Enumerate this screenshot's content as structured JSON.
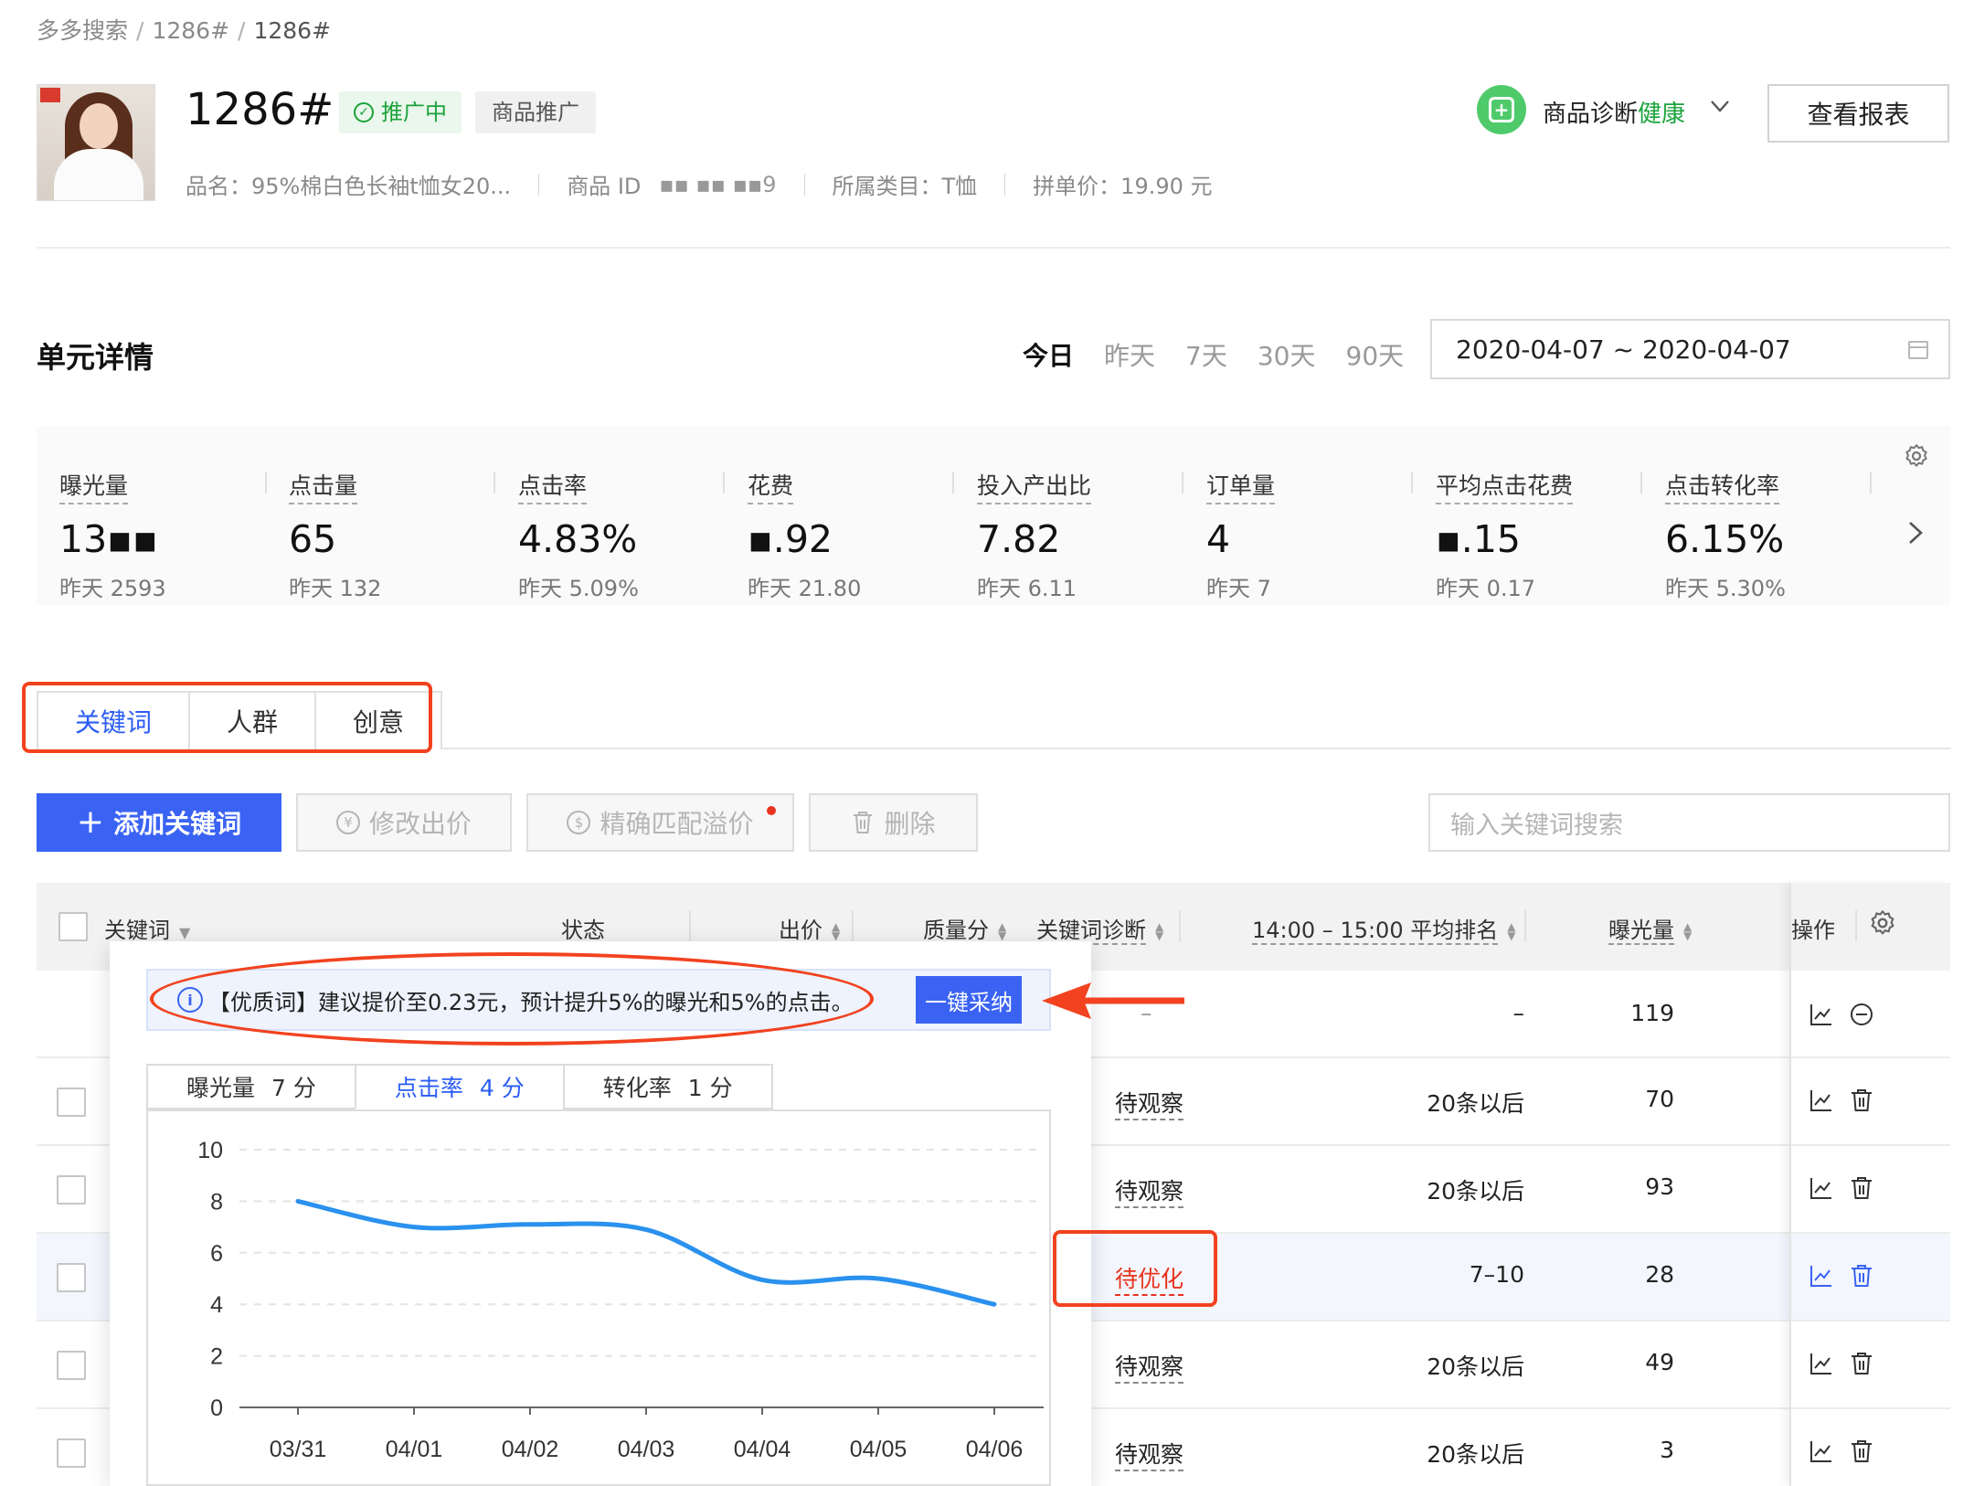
{
  "breadcrumb": {
    "items": [
      "多多搜索",
      "1286#"
    ],
    "current": "1286#"
  },
  "product": {
    "title": "1286#",
    "status": "推广中",
    "type": "商品推广",
    "meta": {
      "name_label": "品名：95%棉白色长袖t恤女20...",
      "id_label": "商品 ID",
      "id_value": "▪▪ ▪▪ ▪▪9",
      "category": "所属类目：T恤",
      "price": "拼单价：19.90 元"
    }
  },
  "header_actions": {
    "diagnosis_label": "商品诊断",
    "diagnosis_status": "健康",
    "report_button": "查看报表"
  },
  "section": {
    "title": "单元详情",
    "ranges": [
      "今日",
      "昨天",
      "7天",
      "30天",
      "90天"
    ],
    "active_range": "今日",
    "date_range": "2020-04-07 ~ 2020-04-07"
  },
  "metrics": [
    {
      "label": "曝光量",
      "value": "13▪▪",
      "prev": "昨天 2593"
    },
    {
      "label": "点击量",
      "value": "65",
      "prev": "昨天 132"
    },
    {
      "label": "点击率",
      "value": "4.83%",
      "prev": "昨天 5.09%"
    },
    {
      "label": "花费",
      "value": "▪.92",
      "prev": "昨天 21.80"
    },
    {
      "label": "投入产出比",
      "value": "7.82",
      "prev": "昨天 6.11"
    },
    {
      "label": "订单量",
      "value": "4",
      "prev": "昨天 7"
    },
    {
      "label": "平均点击花费",
      "value": "▪.15",
      "prev": "昨天 0.17"
    },
    {
      "label": "点击转化率",
      "value": "6.15%",
      "prev": "昨天 5.30%"
    }
  ],
  "tabs": [
    "关键词",
    "人群",
    "创意"
  ],
  "active_tab": "关键词",
  "toolbar": {
    "add_keyword": "添加关键词",
    "edit_bid": "修改出价",
    "exact_premium": "精确匹配溢价",
    "delete": "删除",
    "search_placeholder": "输入关键词搜索"
  },
  "table": {
    "headers": {
      "keyword": "关键词",
      "status": "状态",
      "bid": "出价",
      "quality": "质量分",
      "diagnosis": "关键词诊断",
      "rank": "14:00 – 15:00 平均排名",
      "impressions": "曝光量",
      "ops": "操作"
    },
    "rows": [
      {
        "diagnosis": "–",
        "rank": "–",
        "impressions": "119",
        "diag_kind": "none"
      },
      {
        "diagnosis": "待观察",
        "rank": "20条以后",
        "impressions": "70",
        "diag_kind": "watch"
      },
      {
        "diagnosis": "待观察",
        "rank": "20条以后",
        "impressions": "93",
        "diag_kind": "watch"
      },
      {
        "diagnosis": "待优化",
        "rank": "7–10",
        "impressions": "28",
        "diag_kind": "optimize"
      },
      {
        "diagnosis": "待观察",
        "rank": "20条以后",
        "impressions": "49",
        "diag_kind": "watch"
      },
      {
        "diagnosis": "待观察",
        "rank": "20条以后",
        "impressions": "3",
        "diag_kind": "watch"
      }
    ]
  },
  "popover": {
    "banner": "【优质词】建议提价至0.23元，预计提升5%的曝光和5%的点击。",
    "accept_button": "一键采纳",
    "tabs": [
      {
        "label": "曝光量",
        "score": "7 分"
      },
      {
        "label": "点击率",
        "score": "4 分"
      },
      {
        "label": "转化率",
        "score": "1 分"
      }
    ],
    "active_tab": "点击率"
  },
  "chart_data": {
    "type": "line",
    "x": [
      "03/31",
      "04/01",
      "04/02",
      "04/03",
      "04/04",
      "04/05",
      "04/06"
    ],
    "series": [
      {
        "values": [
          8,
          7.0,
          7.1,
          6.9,
          4.95,
          5.0,
          4.0
        ]
      }
    ],
    "ylim": [
      0,
      10
    ],
    "yticks": [
      0,
      2,
      4,
      6,
      8,
      10
    ],
    "grid": true,
    "color": "#2a91ee"
  },
  "colors": {
    "primary": "#3a63f4",
    "success": "#1ba33b",
    "danger": "#e8331e",
    "annotation": "#f2421f"
  }
}
